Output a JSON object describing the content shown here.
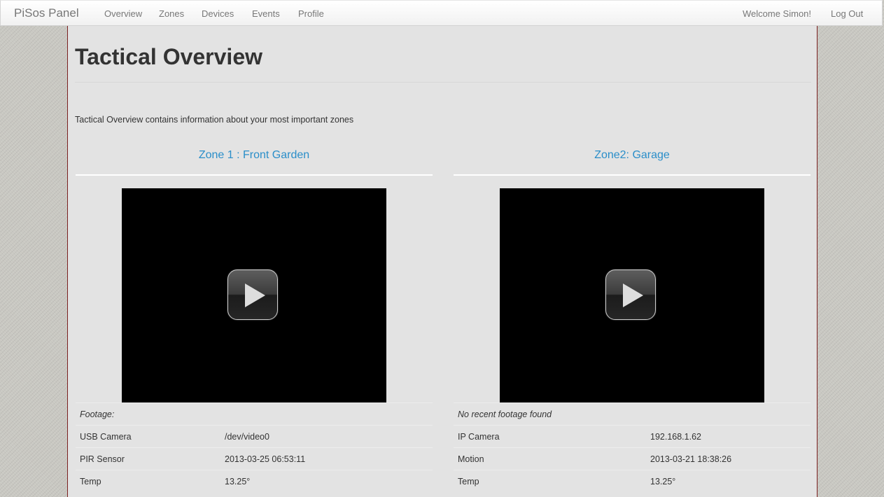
{
  "navbar": {
    "brand": "PiSos Panel",
    "links": [
      "Overview",
      "Zones",
      "Devices",
      "Events",
      "Profile"
    ],
    "welcome": "Welcome Simon!",
    "logout": "Log Out"
  },
  "page": {
    "title": "Tactical Overview",
    "intro": "Tactical Overview contains information about your most important zones"
  },
  "zones": [
    {
      "title": "Zone 1 : Front Garden",
      "footage": "Footage:",
      "rows": [
        {
          "label": "USB Camera",
          "value": "/dev/video0"
        },
        {
          "label": "PIR Sensor",
          "value": "2013-03-25 06:53:11"
        },
        {
          "label": "Temp",
          "value": "13.25°"
        }
      ]
    },
    {
      "title": "Zone2: Garage",
      "footage": "No recent footage found",
      "rows": [
        {
          "label": "IP Camera",
          "value": "192.168.1.62"
        },
        {
          "label": "Motion",
          "value": "2013-03-21 18:38:26"
        },
        {
          "label": "Temp",
          "value": "13.25°"
        }
      ]
    }
  ],
  "colors": {
    "accent": "#2a8ec9",
    "content_border": "#7a1f1f",
    "content_bg": "#e3e3e3"
  },
  "icons": {
    "play": "play-icon"
  }
}
